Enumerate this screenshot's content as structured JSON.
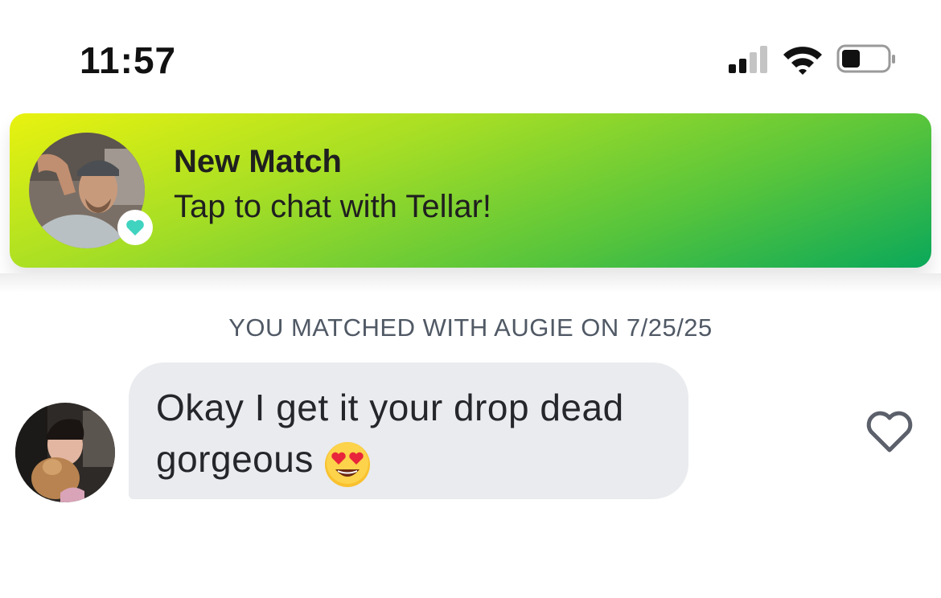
{
  "status_bar": {
    "time": "11:57",
    "icons": [
      "cellular-signal-icon",
      "wifi-icon",
      "battery-icon"
    ],
    "battery_level": 0.35
  },
  "notification": {
    "title": "New Match",
    "subtitle": "Tap to chat with Tellar!",
    "avatar_icon": "avatar-photo",
    "badge_icon": "heart-badge-icon",
    "colors": {
      "gradient_start": "#e9f20f",
      "gradient_end": "#0aa85a",
      "badge_heart": "#3fd3c0"
    }
  },
  "conversation": {
    "match_info": "YOU MATCHED WITH AUGIE ON 7/25/25",
    "messages": [
      {
        "text": "Okay I get it your drop dead gorgeous",
        "emoji": "heart-eyes-emoji-icon",
        "sender_avatar": "avatar-photo",
        "liked": false
      }
    ],
    "colors": {
      "bubble": "#e9ebee",
      "heart_outline": "#5b606b"
    }
  }
}
